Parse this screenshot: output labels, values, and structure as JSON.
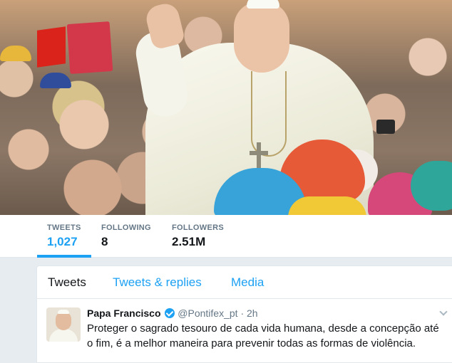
{
  "profile_nav": {
    "stats": [
      {
        "label": "TWEETS",
        "value": "1,027"
      },
      {
        "label": "FOLLOWING",
        "value": "8"
      },
      {
        "label": "FOLLOWERS",
        "value": "2.51M"
      }
    ],
    "active_stat": "TWEETS"
  },
  "timeline": {
    "tabs": [
      {
        "label": "Tweets"
      },
      {
        "label": "Tweets & replies"
      },
      {
        "label": "Media"
      }
    ],
    "active_tab": "Tweets",
    "tweet": {
      "display_name": "Papa Francisco",
      "verified": true,
      "handle": "@Pontifex_pt",
      "separator": "·",
      "time": "2h",
      "text": "Proteger o sagrado tesouro de cada vida humana, desde a concepção até o fim, é a melhor maneira para prevenir todas as formas de violência."
    }
  },
  "colors": {
    "accent": "#1da1f2",
    "text_primary": "#14171a",
    "text_secondary": "#657786",
    "background": "#e6ecf0"
  },
  "icons": [
    "verified-icon",
    "chevron-down-icon"
  ]
}
